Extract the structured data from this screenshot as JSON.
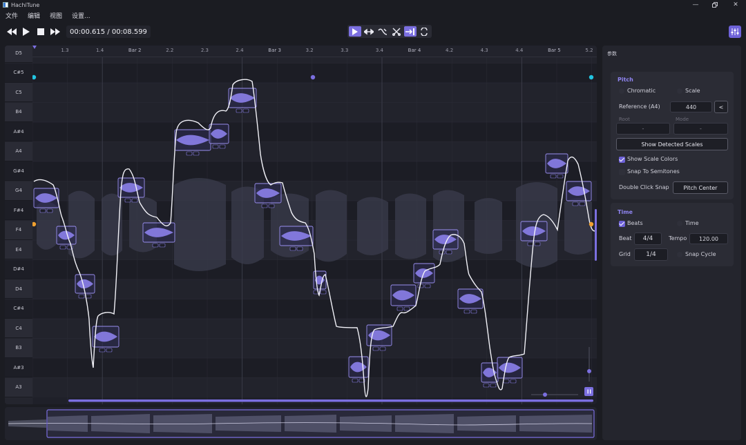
{
  "app": {
    "title": "HachiTune"
  },
  "menu": [
    "文件",
    "编辑",
    "视图",
    "设置..."
  ],
  "transport": {
    "time_current": "00:00.615",
    "time_separator": " / ",
    "time_total": "00:08.599"
  },
  "ruler": {
    "ticks": [
      "1.3",
      "1.4",
      "Bar 2",
      "2.2",
      "2.3",
      "2.4",
      "Bar 3",
      "3.2",
      "3.3",
      "3.4",
      "Bar 4",
      "4.2",
      "4.3",
      "4.4",
      "Bar 5",
      "5.2"
    ]
  },
  "piano": {
    "keys": [
      "D5",
      "C#5",
      "C5",
      "B4",
      "A#4",
      "A4",
      "G#4",
      "G4",
      "F#4",
      "F4",
      "E4",
      "D#4",
      "D4",
      "C#4",
      "C4",
      "B3",
      "A#3",
      "A3"
    ]
  },
  "params": {
    "title": "参数",
    "pitch": {
      "title": "Pitch",
      "chromatic_label": "Chromatic",
      "scale_label": "Scale",
      "reference_label": "Reference (A4)",
      "reference_value": "440",
      "reference_btn": "<",
      "root_label": "Root",
      "mode_label": "Mode",
      "root_value": "-",
      "mode_value": "-",
      "show_detected_label": "Show Detected Scales",
      "show_scale_colors_label": "Show Scale Colors",
      "show_scale_colors_checked": true,
      "snap_semitones_label": "Snap To Semitones",
      "snap_semitones_checked": false,
      "double_click_label": "Double Click Snap",
      "double_click_value": "Pitch Center"
    },
    "time": {
      "title": "Time",
      "beats_label": "Beats",
      "beats_checked": true,
      "time_label": "Time",
      "beat_label": "Beat",
      "beat_value": "4/4",
      "tempo_label": "Tempo",
      "tempo_value": "120.00",
      "grid_label": "Grid",
      "grid_value": "1/4",
      "snap_cycle_label": "Snap Cycle"
    }
  },
  "colors": {
    "accent": "#7b6fe0",
    "note_fill": "#8b80ea",
    "cyan": "#22c4e0",
    "orange": "#f0a030"
  }
}
